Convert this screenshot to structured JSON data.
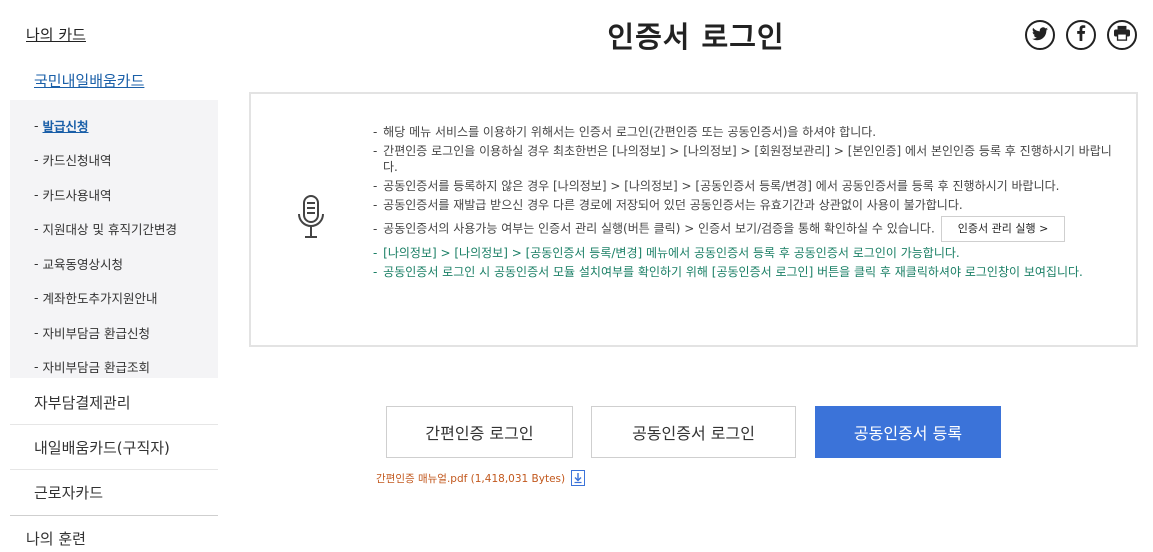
{
  "sidebar": {
    "top_label": "나의 카드",
    "sub_label": "국민내일배움카드",
    "items": [
      {
        "label": "발급신청",
        "active": true
      },
      {
        "label": "카드신청내역"
      },
      {
        "label": "카드사용내역"
      },
      {
        "label": "지원대상 및 휴직기간변경"
      },
      {
        "label": "교육동영상시청"
      },
      {
        "label": "계좌한도추가지원안내"
      },
      {
        "label": "자비부담금 환급신청"
      },
      {
        "label": "자비부담금 환급조회"
      }
    ],
    "dash": "-",
    "main_items": [
      "자부담결제관리",
      "내일배움카드(구직자)",
      "근로자카드"
    ],
    "bottom_label": "나의 훈련"
  },
  "header": {
    "title": "인증서 로그인",
    "share_icons": [
      "twitter-icon",
      "facebook-icon",
      "print-icon"
    ]
  },
  "notice": {
    "icon": "microphone-icon",
    "lines": [
      {
        "text": "해당 메뉴 서비스를 이용하기 위해서는 인증서 로그인(간편인증 또는 공동인증서)을 하셔야 합니다.",
        "color": "#444444"
      },
      {
        "text": "간편인증 로그인을 이용하실 경우 최초한번은 [나의정보] > [나의정보] > [회원정보관리] > [본인인증] 에서 본인인증 등록 후 진행하시기 바랍니다.",
        "color": "#444444"
      },
      {
        "text": "공동인증서를 등록하지 않은 경우 [나의정보] > [나의정보] > [공동인증서 등록/변경] 에서 공동인증서를 등록 후 진행하시기 바랍니다.",
        "color": "#444444"
      },
      {
        "text": "공동인증서를 재발급 받으신 경우 다른 경로에 저장되어 있던 공동인증서는 유효기간과 상관없이 사용이 불가합니다.",
        "color": "#444444"
      },
      {
        "text": "공동인증서의 사용가능 여부는 인증서 관리 실행(버튼 클릭) > 인증서 보기/검증을 통해 확인하실 수 있습니다.",
        "color": "#444444"
      },
      {
        "text": "[나의정보] > [나의정보] > [공동인증서 등록/변경] 메뉴에서 공동인증서 등록 후 공동인증서 로그인이 가능합니다.",
        "color": "#1a7f65"
      },
      {
        "text": "공동인증서 로그인 시 공동인증서 모듈 설치여부를 확인하기 위해 [공동인증서 로그인] 버튼을 클릭 후 재클릭하셔야 로그인창이 보여집니다.",
        "color": "#1a7f65"
      }
    ],
    "manager_button": "인증서 관리 실행 >"
  },
  "buttons": {
    "simple_login": "간편인증 로그인",
    "cert_login": "공동인증서 로그인",
    "cert_register": "공동인증서 등록"
  },
  "manual": {
    "label": "간편인증 매뉴얼.pdf (1,418,031 Bytes)",
    "icon": "download-icon"
  },
  "colors": {
    "primary": "#3b73d9",
    "link": "#1a5fa8",
    "notice_green": "#1a7f65",
    "manual_orange": "#c2581d"
  }
}
